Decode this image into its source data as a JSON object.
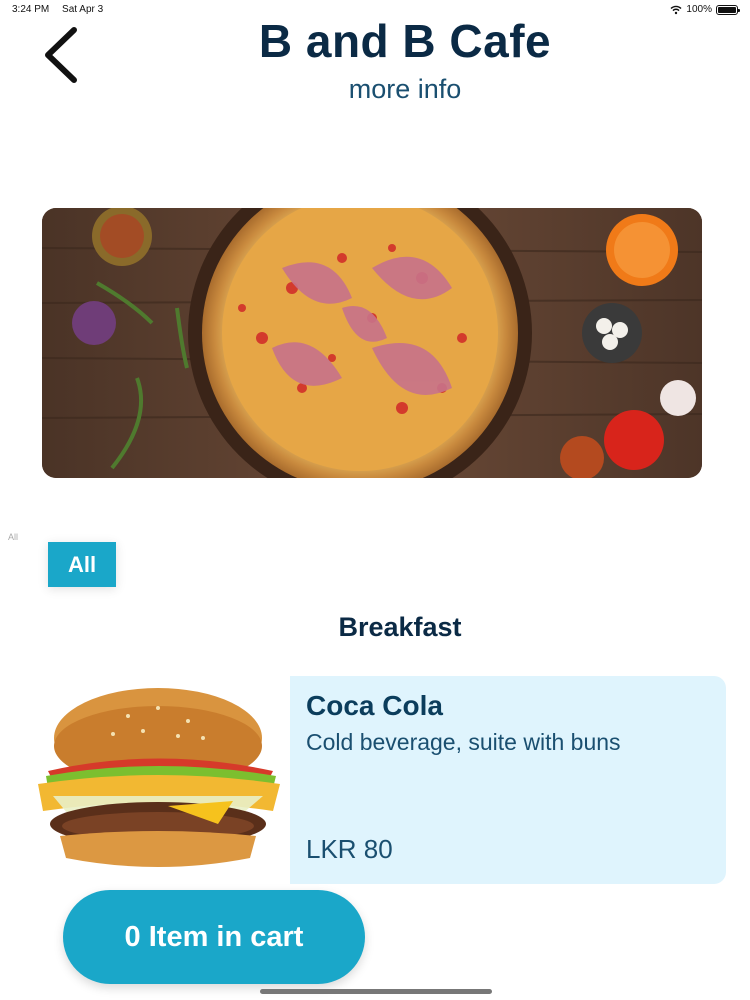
{
  "status_bar": {
    "time": "3:24 PM",
    "date": "Sat Apr 3",
    "battery": "100%"
  },
  "header": {
    "title": "B and B Cafe",
    "subtitle": "more info",
    "back_icon": "chevron-left-icon"
  },
  "hero": {
    "image": "pizza-on-wooden-table"
  },
  "filters": {
    "hidden_label": "All",
    "chips": [
      {
        "label": "All",
        "selected": true
      }
    ]
  },
  "section": {
    "title": "Breakfast"
  },
  "items": [
    {
      "name": "Coca Cola",
      "description": "Cold beverage, suite with buns",
      "price": "LKR 80",
      "image": "burger"
    }
  ],
  "cart": {
    "label": "0 Item in cart"
  },
  "colors": {
    "accent": "#1aa7c9",
    "title": "#0b2a45",
    "card_bg": "#dff4fd"
  }
}
